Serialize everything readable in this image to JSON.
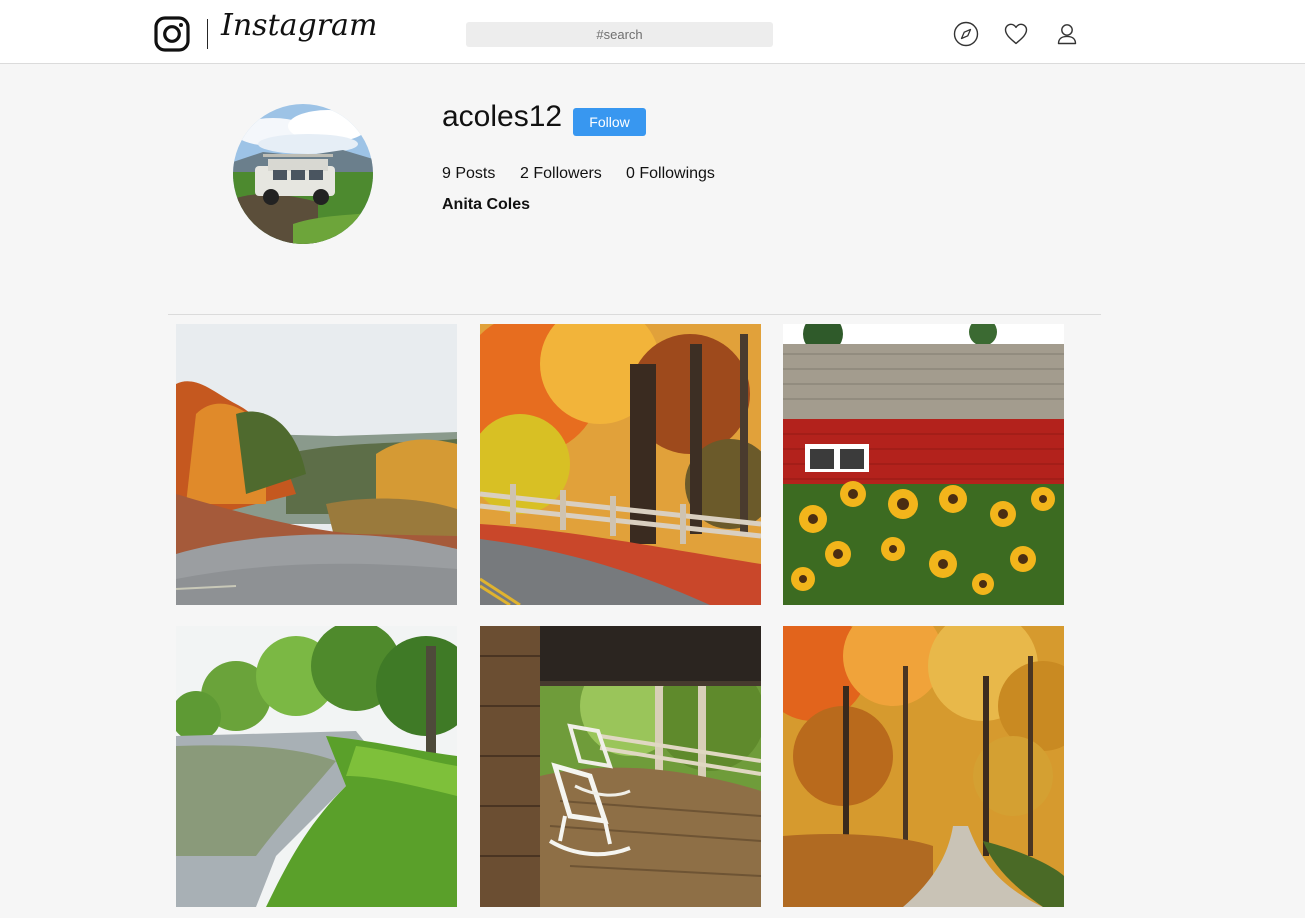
{
  "header": {
    "brand": "Instagram",
    "search": {
      "placeholder": "#search",
      "value": ""
    },
    "icons": [
      "instagram-logo-icon",
      "compass-icon",
      "heart-icon",
      "user-icon"
    ]
  },
  "profile": {
    "username": "acoles12",
    "follow_label": "Follow",
    "posts_count": "9 Posts",
    "followers_count": "2 Followers",
    "followings_count": "0 Followings",
    "full_name": "Anita Coles"
  },
  "colors": {
    "accent": "#3897f0",
    "background": "#f6f6f6",
    "header_bg": "#ffffff",
    "divider": "#dbdbdb"
  },
  "posts": [
    {
      "scene": "autumn-road-hills"
    },
    {
      "scene": "autumn-trees-fence-road"
    },
    {
      "scene": "red-barn-sunflowers"
    },
    {
      "scene": "river-green-trees"
    },
    {
      "scene": "porch-rocking-chairs"
    },
    {
      "scene": "autumn-forest-lane"
    }
  ]
}
